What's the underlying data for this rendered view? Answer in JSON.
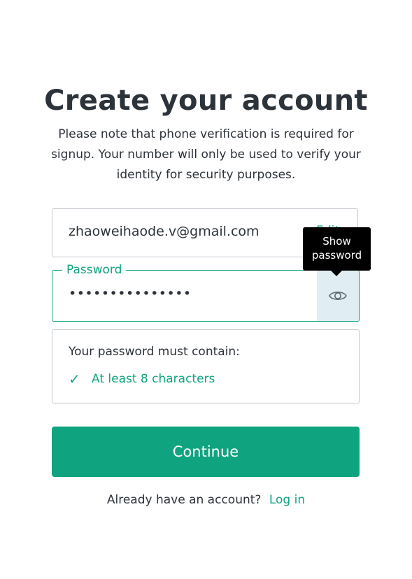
{
  "header": {
    "title": "Create your account",
    "subtitle": "Please note that phone verification is required for signup. Your number will only be used to verify your identity for security purposes."
  },
  "email": {
    "value": "zhaoweihaode.v@gmail.com",
    "edit_label": "Edit"
  },
  "password": {
    "label": "Password",
    "value": "•••••••••••••••",
    "toggle_icon": "eye-icon",
    "tooltip": "Show password"
  },
  "requirements": {
    "title": "Your password must contain:",
    "items": [
      {
        "label": "At least 8 characters",
        "status_icon": "checkmark-icon",
        "met": true
      }
    ]
  },
  "actions": {
    "continue_label": "Continue"
  },
  "footer": {
    "prompt": "Already have an account?",
    "login_label": "Log in"
  },
  "colors": {
    "accent": "#10a37f",
    "text": "#2d333a",
    "border": "#c2c8d0",
    "eye_button_bg": "#e0edf2",
    "tooltip_bg": "#000000"
  }
}
